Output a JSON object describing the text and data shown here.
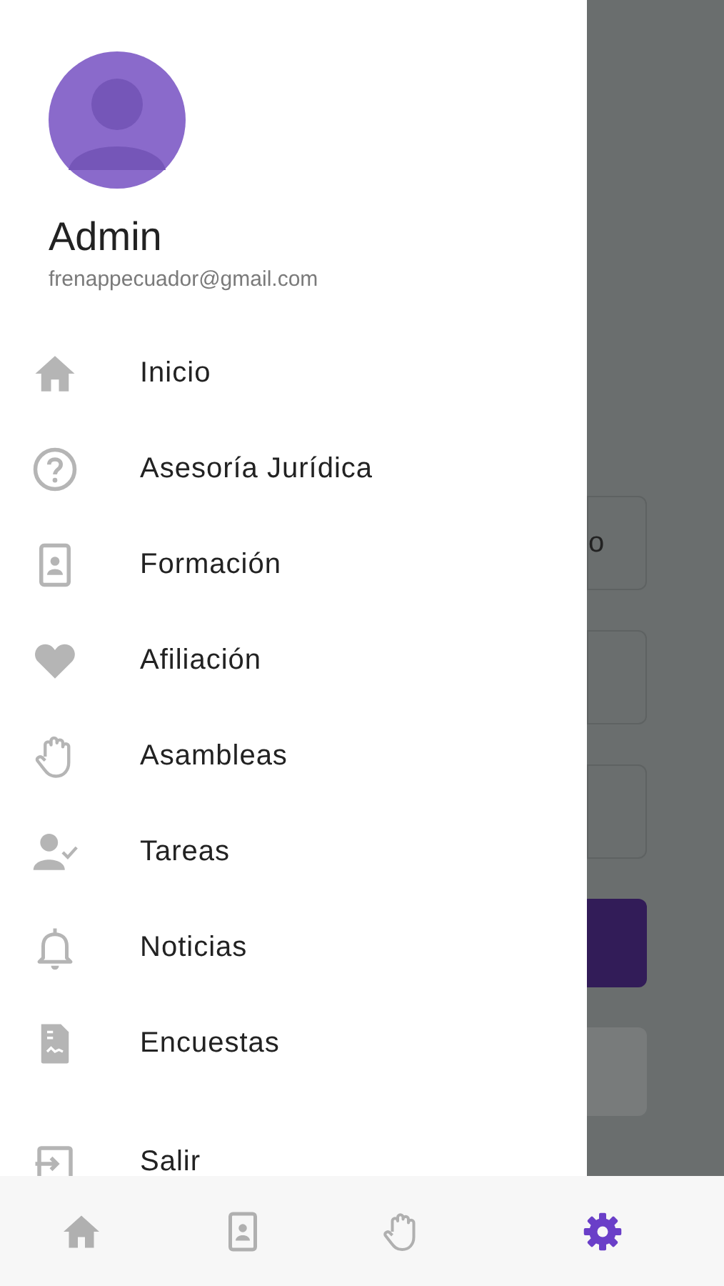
{
  "profile": {
    "name": "Admin",
    "email": "frenappecuador@gmail.com"
  },
  "menu": [
    {
      "label": "Inicio"
    },
    {
      "label": "Asesoría Jurídica"
    },
    {
      "label": "Formación"
    },
    {
      "label": "Afiliación"
    },
    {
      "label": "Asambleas"
    },
    {
      "label": "Tareas"
    },
    {
      "label": "Noticias"
    },
    {
      "label": "Encuestas"
    }
  ],
  "footer_menu": [
    {
      "label": "Salir"
    }
  ],
  "background": [
    {
      "kind": "field",
      "value": "o"
    },
    {
      "kind": "field"
    },
    {
      "kind": "field"
    },
    {
      "kind": "button"
    },
    {
      "kind": "light-button"
    }
  ],
  "bottom_nav": [
    {
      "selected": false
    },
    {
      "selected": false
    },
    {
      "selected": false
    },
    {
      "selected": true
    }
  ]
}
